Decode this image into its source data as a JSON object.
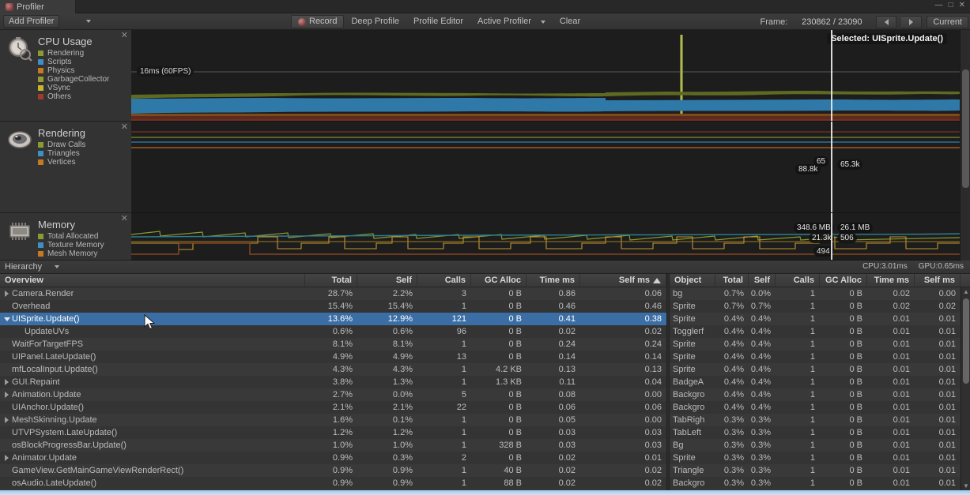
{
  "window": {
    "tab_title": "Profiler",
    "tab_icon": "profiler-icon",
    "buttons": [
      "minimize",
      "maximize",
      "close"
    ]
  },
  "toolbar": {
    "add_profiler_label": "Add Profiler",
    "record_label": "Record",
    "deep_profile_label": "Deep Profile",
    "profile_editor_label": "Profile Editor",
    "active_profiler_label": "Active Profiler",
    "clear_label": "Clear",
    "frame_label": "Frame:",
    "frame_value": "230862 / 23090",
    "current_label": "Current"
  },
  "modules": [
    {
      "title": "CPU Usage",
      "icon": "stopwatch-icon",
      "legend": [
        {
          "label": "Rendering",
          "color": "#8a9b2f"
        },
        {
          "label": "Scripts",
          "color": "#3d8fc4"
        },
        {
          "label": "Physics",
          "color": "#c47a22"
        },
        {
          "label": "GarbageCollector",
          "color": "#9a9a32"
        },
        {
          "label": "VSync",
          "color": "#c8b52c"
        },
        {
          "label": "Others",
          "color": "#9e3b2e"
        }
      ]
    },
    {
      "title": "Rendering",
      "icon": "camera-icon",
      "legend": [
        {
          "label": "Draw Calls",
          "color": "#8a9b2f"
        },
        {
          "label": "Triangles",
          "color": "#3d8fc4"
        },
        {
          "label": "Vertices",
          "color": "#c47a22"
        }
      ]
    },
    {
      "title": "Memory",
      "icon": "memory-chip-icon",
      "legend": [
        {
          "label": "Total Allocated",
          "color": "#8a9b2f"
        },
        {
          "label": "Texture Memory",
          "color": "#3d8fc4"
        },
        {
          "label": "Mesh Memory",
          "color": "#c47a22"
        }
      ]
    }
  ],
  "graphs": {
    "cpu": {
      "threshold_label": "16ms (60FPS)",
      "selected_label": "Selected: UISprite.Update()"
    },
    "rendering": {
      "labels_left": [
        "65",
        "88.8k"
      ],
      "labels_right": [
        "65.3k"
      ]
    },
    "memory": {
      "labels_left": [
        "348.6 MB",
        "21.3k",
        "494"
      ],
      "labels_right": [
        "26.1 MB",
        "506"
      ]
    }
  },
  "hierarchy_bar": {
    "mode_label": "Hierarchy",
    "cpu_stat": "CPU:3.01ms",
    "gpu_stat": "GPU:0.65ms"
  },
  "left_table": {
    "columns": [
      "Overview",
      "Total",
      "Self",
      "Calls",
      "GC Alloc",
      "Time ms",
      "Self ms"
    ],
    "sort_column": "Self ms",
    "rows": [
      {
        "name": "Camera.Render",
        "indent": 0,
        "foldout": "closed",
        "total": "28.7%",
        "self": "2.2%",
        "calls": "3",
        "gc": "0 B",
        "time": "0.86",
        "selfms": "0.06",
        "selected": false
      },
      {
        "name": "Overhead",
        "indent": 0,
        "foldout": "none",
        "total": "15.4%",
        "self": "15.4%",
        "calls": "1",
        "gc": "0 B",
        "time": "0.46",
        "selfms": "0.46",
        "selected": false
      },
      {
        "name": "UISprite.Update()",
        "indent": 0,
        "foldout": "open",
        "total": "13.6%",
        "self": "12.9%",
        "calls": "121",
        "gc": "0 B",
        "time": "0.41",
        "selfms": "0.38",
        "selected": true
      },
      {
        "name": "UpdateUVs",
        "indent": 1,
        "foldout": "none",
        "total": "0.6%",
        "self": "0.6%",
        "calls": "96",
        "gc": "0 B",
        "time": "0.02",
        "selfms": "0.02",
        "selected": false
      },
      {
        "name": "WaitForTargetFPS",
        "indent": 0,
        "foldout": "none",
        "total": "8.1%",
        "self": "8.1%",
        "calls": "1",
        "gc": "0 B",
        "time": "0.24",
        "selfms": "0.24",
        "selected": false
      },
      {
        "name": "UIPanel.LateUpdate()",
        "indent": 0,
        "foldout": "none",
        "total": "4.9%",
        "self": "4.9%",
        "calls": "13",
        "gc": "0 B",
        "time": "0.14",
        "selfms": "0.14",
        "selected": false
      },
      {
        "name": "mfLocalInput.Update()",
        "indent": 0,
        "foldout": "none",
        "total": "4.3%",
        "self": "4.3%",
        "calls": "1",
        "gc": "4.2 KB",
        "time": "0.13",
        "selfms": "0.13",
        "selected": false
      },
      {
        "name": "GUI.Repaint",
        "indent": 0,
        "foldout": "closed",
        "total": "3.8%",
        "self": "1.3%",
        "calls": "1",
        "gc": "1.3 KB",
        "time": "0.11",
        "selfms": "0.04",
        "selected": false
      },
      {
        "name": "Animation.Update",
        "indent": 0,
        "foldout": "closed",
        "total": "2.7%",
        "self": "0.0%",
        "calls": "5",
        "gc": "0 B",
        "time": "0.08",
        "selfms": "0.00",
        "selected": false
      },
      {
        "name": "UIAnchor.Update()",
        "indent": 0,
        "foldout": "none",
        "total": "2.1%",
        "self": "2.1%",
        "calls": "22",
        "gc": "0 B",
        "time": "0.06",
        "selfms": "0.06",
        "selected": false
      },
      {
        "name": "MeshSkinning.Update",
        "indent": 0,
        "foldout": "closed",
        "total": "1.6%",
        "self": "0.1%",
        "calls": "1",
        "gc": "0 B",
        "time": "0.05",
        "selfms": "0.00",
        "selected": false
      },
      {
        "name": "UTVPSystem.LateUpdate()",
        "indent": 0,
        "foldout": "none",
        "total": "1.2%",
        "self": "1.2%",
        "calls": "1",
        "gc": "0 B",
        "time": "0.03",
        "selfms": "0.03",
        "selected": false
      },
      {
        "name": "osBlockProgressBar.Update()",
        "indent": 0,
        "foldout": "none",
        "total": "1.0%",
        "self": "1.0%",
        "calls": "1",
        "gc": "328 B",
        "time": "0.03",
        "selfms": "0.03",
        "selected": false
      },
      {
        "name": "Animator.Update",
        "indent": 0,
        "foldout": "closed",
        "total": "0.9%",
        "self": "0.3%",
        "calls": "2",
        "gc": "0 B",
        "time": "0.02",
        "selfms": "0.01",
        "selected": false
      },
      {
        "name": "GameView.GetMainGameViewRenderRect()",
        "indent": 0,
        "foldout": "none",
        "total": "0.9%",
        "self": "0.9%",
        "calls": "1",
        "gc": "40 B",
        "time": "0.02",
        "selfms": "0.02",
        "selected": false
      },
      {
        "name": "osAudio.LateUpdate()",
        "indent": 0,
        "foldout": "none",
        "total": "0.9%",
        "self": "0.9%",
        "calls": "1",
        "gc": "88 B",
        "time": "0.02",
        "selfms": "0.02",
        "selected": false
      }
    ]
  },
  "right_table": {
    "columns": [
      "Object",
      "Total",
      "Self",
      "Calls",
      "GC Alloc",
      "Time ms",
      "Self ms"
    ],
    "rows": [
      {
        "object": "bg",
        "total": "0.7%",
        "self": "0.0%",
        "calls": "1",
        "gc": "0 B",
        "time": "0.02",
        "selfms": "0.00"
      },
      {
        "object": "Sprite",
        "total": "0.7%",
        "self": "0.7%",
        "calls": "1",
        "gc": "0 B",
        "time": "0.02",
        "selfms": "0.02"
      },
      {
        "object": "Sprite",
        "total": "0.4%",
        "self": "0.4%",
        "calls": "1",
        "gc": "0 B",
        "time": "0.01",
        "selfms": "0.01"
      },
      {
        "object": "Togglerf",
        "total": "0.4%",
        "self": "0.4%",
        "calls": "1",
        "gc": "0 B",
        "time": "0.01",
        "selfms": "0.01"
      },
      {
        "object": "Sprite",
        "total": "0.4%",
        "self": "0.4%",
        "calls": "1",
        "gc": "0 B",
        "time": "0.01",
        "selfms": "0.01"
      },
      {
        "object": "Sprite",
        "total": "0.4%",
        "self": "0.4%",
        "calls": "1",
        "gc": "0 B",
        "time": "0.01",
        "selfms": "0.01"
      },
      {
        "object": "Sprite",
        "total": "0.4%",
        "self": "0.4%",
        "calls": "1",
        "gc": "0 B",
        "time": "0.01",
        "selfms": "0.01"
      },
      {
        "object": "BadgeA",
        "total": "0.4%",
        "self": "0.4%",
        "calls": "1",
        "gc": "0 B",
        "time": "0.01",
        "selfms": "0.01"
      },
      {
        "object": "Backgro",
        "total": "0.4%",
        "self": "0.4%",
        "calls": "1",
        "gc": "0 B",
        "time": "0.01",
        "selfms": "0.01"
      },
      {
        "object": "Backgro",
        "total": "0.4%",
        "self": "0.4%",
        "calls": "1",
        "gc": "0 B",
        "time": "0.01",
        "selfms": "0.01"
      },
      {
        "object": "TabRigh",
        "total": "0.3%",
        "self": "0.3%",
        "calls": "1",
        "gc": "0 B",
        "time": "0.01",
        "selfms": "0.01"
      },
      {
        "object": "TabLeft",
        "total": "0.3%",
        "self": "0.3%",
        "calls": "1",
        "gc": "0 B",
        "time": "0.01",
        "selfms": "0.01"
      },
      {
        "object": "Bg",
        "total": "0.3%",
        "self": "0.3%",
        "calls": "1",
        "gc": "0 B",
        "time": "0.01",
        "selfms": "0.01"
      },
      {
        "object": "Sprite",
        "total": "0.3%",
        "self": "0.3%",
        "calls": "1",
        "gc": "0 B",
        "time": "0.01",
        "selfms": "0.01"
      },
      {
        "object": "Triangle",
        "total": "0.3%",
        "self": "0.3%",
        "calls": "1",
        "gc": "0 B",
        "time": "0.01",
        "selfms": "0.01"
      },
      {
        "object": "Backgro",
        "total": "0.3%",
        "self": "0.3%",
        "calls": "1",
        "gc": "0 B",
        "time": "0.01",
        "selfms": "0.01"
      }
    ]
  },
  "colors": {
    "selection": "#3a6ea5",
    "panel": "#393939",
    "graph_bg": "#1d1d1d",
    "rendering": "#8a9b2f",
    "scripts": "#3d8fc4",
    "physics": "#c47a22",
    "gc": "#9a9a32",
    "vsync": "#c8b52c",
    "others": "#9e3b2e"
  }
}
